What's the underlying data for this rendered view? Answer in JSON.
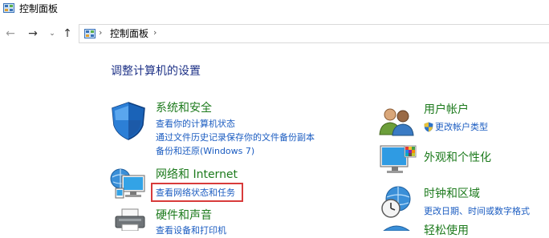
{
  "window": {
    "title": "控制面板"
  },
  "nav": {
    "back_glyph": "←",
    "forward_glyph": "→",
    "recent_glyph": "⌄",
    "up_glyph": "↑"
  },
  "address": {
    "separator": "›",
    "location": "控制面板"
  },
  "main": {
    "heading": "调整计算机的设置",
    "left_categories": [
      {
        "title": "系统和安全",
        "icon": "shield-icon",
        "links": [
          "查看你的计算机状态",
          "通过文件历史记录保存你的文件备份副本",
          "备份和还原(Windows 7)"
        ]
      },
      {
        "title": "网络和 Internet",
        "icon": "network-icon",
        "links": [
          "查看网络状态和任务"
        ]
      },
      {
        "title": "硬件和声音",
        "icon": "printer-icon",
        "links": [
          "查看设备和打印机"
        ]
      }
    ],
    "right_categories": [
      {
        "title": "用户帐户",
        "icon": "users-icon",
        "links": [
          "更改帐户类型"
        ]
      },
      {
        "title": "外观和个性化",
        "icon": "monitor-icon",
        "links": []
      },
      {
        "title": "时钟和区域",
        "icon": "clock-globe-icon",
        "links": [
          "更改日期、时间或数字格式"
        ]
      },
      {
        "title": "轻松使用",
        "icon": "accessibility-icon",
        "links": []
      }
    ]
  },
  "colors": {
    "heading": "#1e3287",
    "category_title": "#1c7a1c",
    "link": "#1b5cc1",
    "highlight_border": "#d83b3b"
  }
}
